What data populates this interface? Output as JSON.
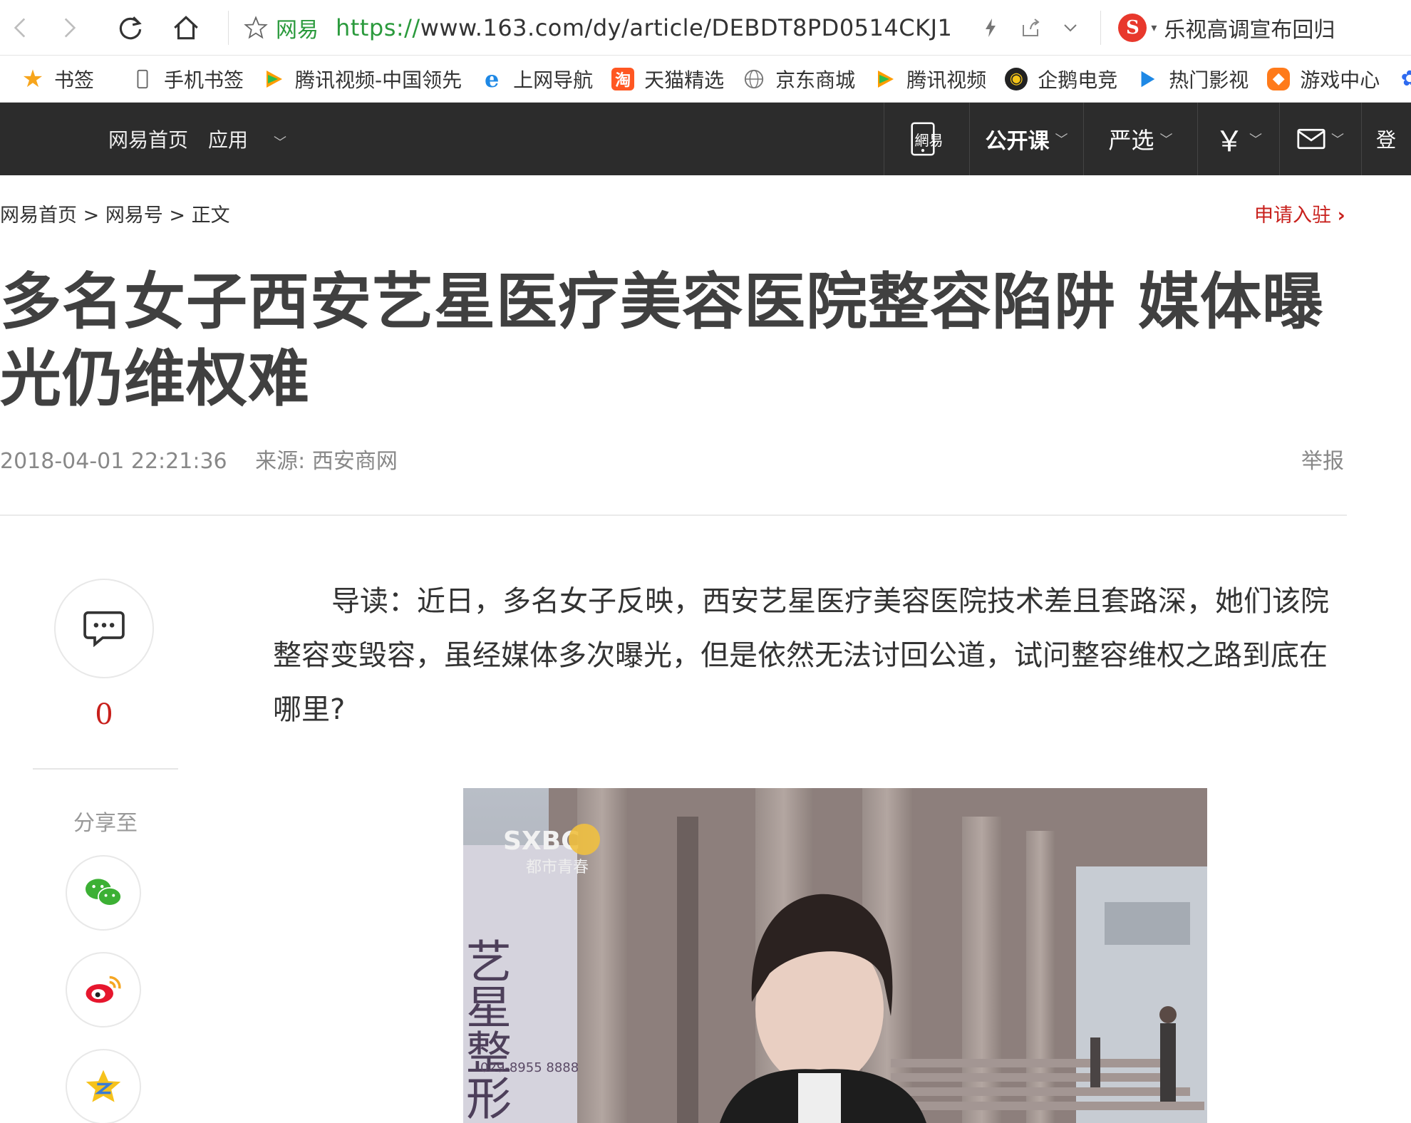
{
  "browser": {
    "site_name": "网易",
    "url_protocol": "https://",
    "url_rest": "www.163.com/dy/article/DEBDT8PD0514CKJ1",
    "search_text": "乐视高调宣布回归"
  },
  "bookmarks": [
    {
      "label": "书签"
    },
    {
      "label": "手机书签"
    },
    {
      "label": "腾讯视频-中国领先"
    },
    {
      "label": "上网导航"
    },
    {
      "label": "天猫精选"
    },
    {
      "label": "京东商城"
    },
    {
      "label": "腾讯视频"
    },
    {
      "label": "企鹅电竞"
    },
    {
      "label": "热门影视"
    },
    {
      "label": "游戏中心"
    }
  ],
  "site_nav": {
    "home": "网易首页",
    "apps": "应用",
    "mobile_logo": "網易",
    "open_course": "公开课",
    "yanxuan": "严选",
    "yuan": "￥",
    "login": "登"
  },
  "breadcrumb": {
    "home": "网易首页",
    "sep": ">",
    "section": "网易号",
    "current": "正文",
    "apply": "申请入驻"
  },
  "article": {
    "title": "多名女子西安艺星医疗美容医院整容陷阱 媒体曝光仍维权难",
    "datetime": "2018-04-01 22:21:36",
    "source": "来源: 西安商网",
    "report": "举报",
    "lead": "导读：近日，多名女子反映，西安艺星医疗美容医院技术差且套路深，她们该院整容变毁容，虽经媒体多次曝光，但是依然无法讨回公道，试问整容维权之路到底在哪里?"
  },
  "rail": {
    "comment_count": "0",
    "share_label": "分享至"
  },
  "photo": {
    "channel_logo": "SXBC",
    "channel_sub": "都市青春",
    "sign_text": "艺星整形",
    "sign_phone": "029-8955 8888"
  }
}
